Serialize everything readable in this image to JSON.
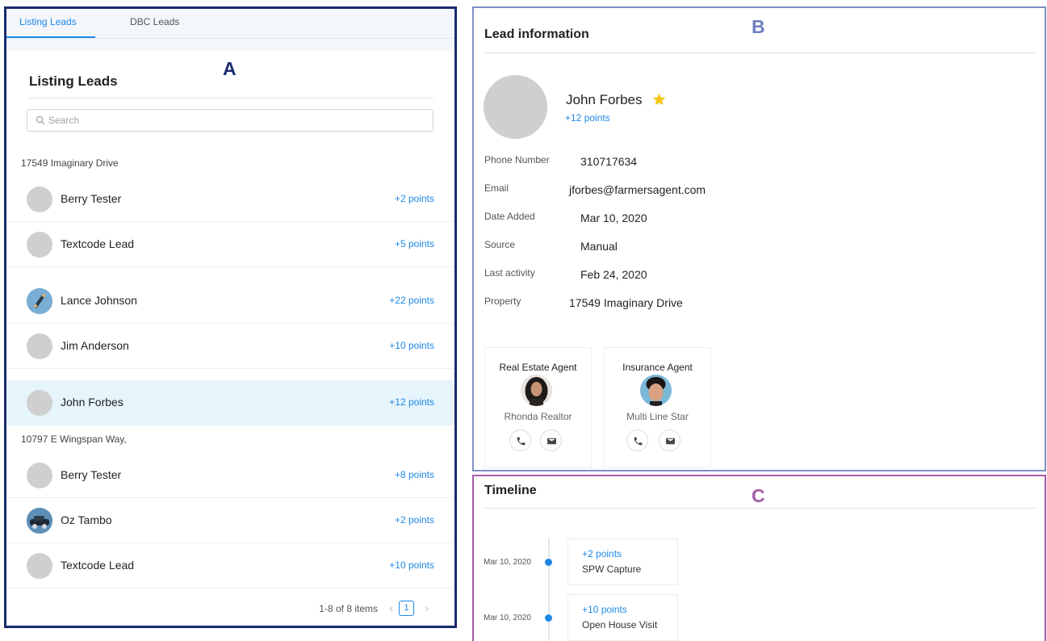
{
  "tabs": [
    {
      "label": "Listing Leads",
      "active": true
    },
    {
      "label": "DBC Leads",
      "active": false
    }
  ],
  "list": {
    "title": "Listing Leads",
    "search_placeholder": "Search",
    "groups": [
      {
        "address": "17549 Imaginary Drive"
      },
      {
        "address": "10797 E Wingspan Way,"
      }
    ],
    "rows": [
      {
        "name": "Berry Tester",
        "points": "+2 points",
        "avatar": "default"
      },
      {
        "name": "Textcode Lead",
        "points": "+5 points",
        "avatar": "default"
      },
      {
        "name": "Lance Johnson",
        "points": "+22 points",
        "avatar": "photo-skateboard"
      },
      {
        "name": "Jim Anderson",
        "points": "+10 points",
        "avatar": "default"
      },
      {
        "name": "John Forbes",
        "points": "+12 points",
        "avatar": "default",
        "selected": true
      },
      {
        "name": "Berry Tester",
        "points": "+8 points",
        "avatar": "default"
      },
      {
        "name": "Oz Tambo",
        "points": "+2 points",
        "avatar": "photo-car"
      },
      {
        "name": "Textcode Lead",
        "points": "+10 points",
        "avatar": "default"
      }
    ],
    "pagination": {
      "range": "1-8 of 8 items",
      "current_page": "1",
      "prev": "‹",
      "next": "›"
    }
  },
  "labels": {
    "a": "A",
    "b": "B",
    "c": "C"
  },
  "colors": {
    "accent": "#1e88e5",
    "panel_a": "#1a2b6d",
    "panel_b": "#7f8fc4",
    "panel_c": "#a65ca6",
    "star": "#f5c518"
  },
  "lead": {
    "section_title": "Lead information",
    "name": "John Forbes",
    "starred": true,
    "points": "+12 points",
    "fields": [
      {
        "label": "Phone Number",
        "value": "310717634"
      },
      {
        "label": "Email",
        "value": "jforbes@farmersagent.com"
      },
      {
        "label": "Date Added",
        "value": "Mar 10, 2020"
      },
      {
        "label": "Source",
        "value": "Manual"
      },
      {
        "label": "Last activity",
        "value": "Feb 24, 2020"
      },
      {
        "label": "Property",
        "value": "17549 Imaginary Drive"
      }
    ],
    "agents": [
      {
        "role": "Real Estate Agent",
        "name": "Rhonda Realtor",
        "actions": [
          "phone-icon",
          "email-icon"
        ]
      },
      {
        "role": "Insurance Agent",
        "name": "Multi Line Star",
        "actions": [
          "phone-icon",
          "email-icon"
        ]
      }
    ]
  },
  "timeline": {
    "title": "Timeline",
    "events": [
      {
        "date": "Mar 10, 2020",
        "points": "+2 points",
        "event": "SPW Capture"
      },
      {
        "date": "Mar 10, 2020",
        "points": "+10 points",
        "event": "Open House Visit"
      }
    ]
  }
}
